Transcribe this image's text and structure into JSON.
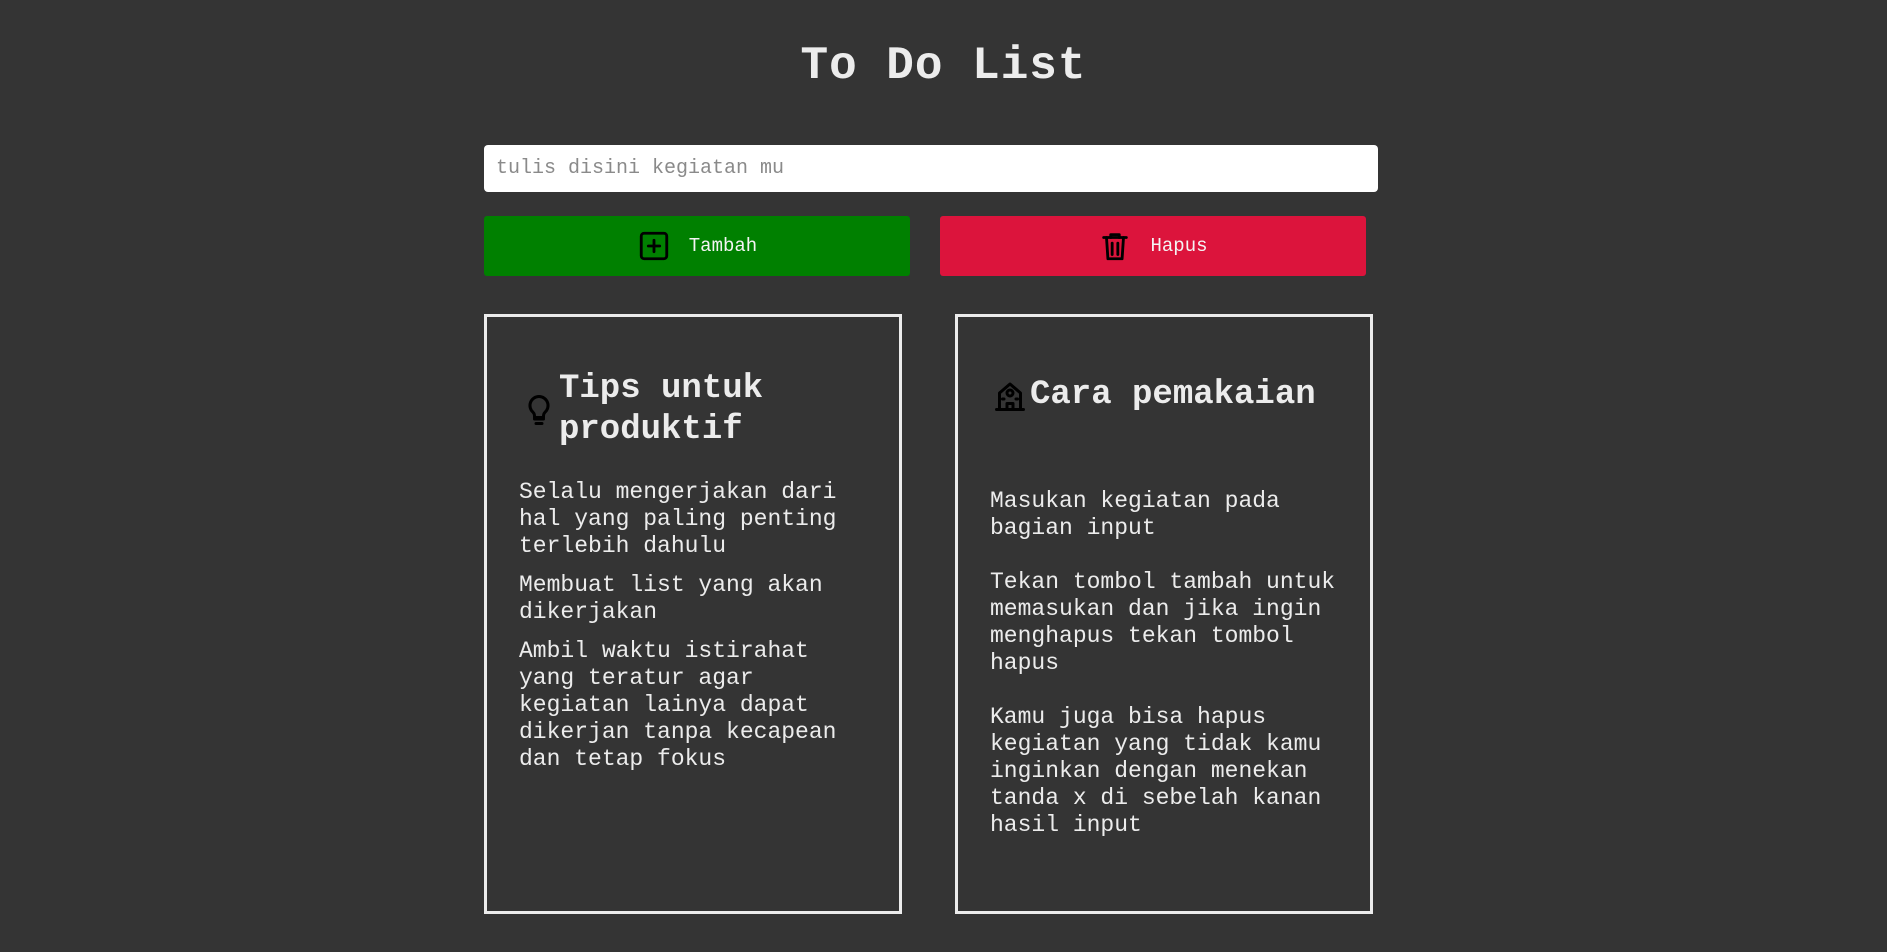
{
  "header": {
    "title": "To Do List"
  },
  "input": {
    "placeholder": "tulis disini kegiatan mu",
    "value": ""
  },
  "buttons": {
    "add": {
      "label": "Tambah",
      "icon": "plus-square-icon",
      "color": "#008000"
    },
    "delete": {
      "label": "Hapus",
      "icon": "trash-icon",
      "color": "#dc143c"
    }
  },
  "tips_card": {
    "icon": "lightbulb-icon",
    "title": "Tips untuk produktif",
    "items": [
      "Selalu mengerjakan dari hal yang paling penting terlebih dahulu",
      "Membuat list yang akan dikerjakan",
      "Ambil waktu istirahat yang teratur agar kegiatan lainya dapat dikerjan tanpa kecapean dan tetap fokus"
    ]
  },
  "howto_card": {
    "icon": "building-icon",
    "title": "Cara pemakaian",
    "items": [
      "Masukan kegiatan pada bagian input",
      "Tekan tombol tambah untuk memasukan dan jika ingin menghapus tekan tombol hapus",
      "Kamu juga bisa hapus kegiatan yang tidak kamu inginkan dengan menekan tanda x di sebelah kanan hasil input"
    ]
  },
  "colors": {
    "background": "#343434",
    "text": "#ececec",
    "add_button": "#008000",
    "delete_button": "#dc143c"
  }
}
